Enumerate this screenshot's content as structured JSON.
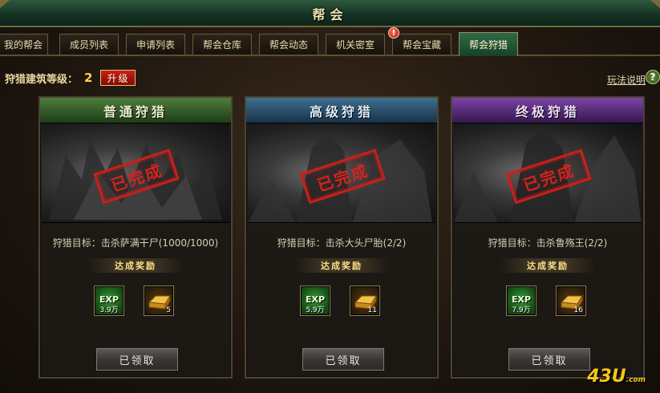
{
  "window": {
    "title": "帮会"
  },
  "tabs": [
    {
      "label": "我的帮会",
      "active": false
    },
    {
      "label": "成员列表",
      "active": false
    },
    {
      "label": "申请列表",
      "active": false
    },
    {
      "label": "帮会仓库",
      "active": false
    },
    {
      "label": "帮会动态",
      "active": false
    },
    {
      "label": "机关密室",
      "active": false
    },
    {
      "label": "帮会宝藏",
      "active": false,
      "alert": "!"
    },
    {
      "label": "帮会狩猎",
      "active": true
    }
  ],
  "level": {
    "label": "狩猎建筑等级：",
    "value": "2",
    "upgrade_label": "升级"
  },
  "help_link": "玩法说明",
  "help_icon": "?",
  "panels": [
    {
      "title": "普通狩猎",
      "stamp": "已完成",
      "target": "狩猎目标：击杀萨满干尸(1000/1000)",
      "reward_label": "达成奖励",
      "exp_label": "EXP",
      "exp_amount": "3.9万",
      "gold_count": "5",
      "claim_label": "已领取",
      "theme_color": "#4f7d3a"
    },
    {
      "title": "高级狩猎",
      "stamp": "已完成",
      "target": "狩猎目标：击杀大头尸胎(2/2)",
      "reward_label": "达成奖励",
      "exp_label": "EXP",
      "exp_amount": "5.9万",
      "gold_count": "11",
      "claim_label": "已领取",
      "theme_color": "#3f6f8f"
    },
    {
      "title": "终极狩猎",
      "stamp": "已完成",
      "target": "狩猎目标：击杀鲁殇王(2/2)",
      "reward_label": "达成奖励",
      "exp_label": "EXP",
      "exp_amount": "7.9万",
      "gold_count": "16",
      "claim_label": "已领取",
      "theme_color": "#7b44a4"
    }
  ],
  "watermark": {
    "main": "43U",
    "suffix": ".com"
  }
}
